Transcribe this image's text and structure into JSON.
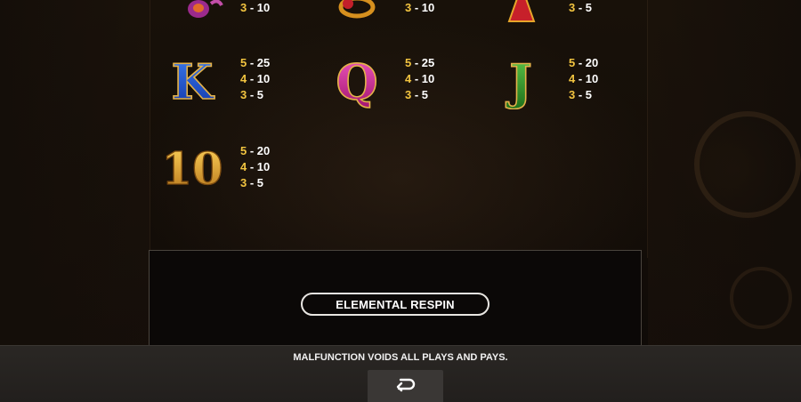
{
  "paytable": {
    "partial_row": [
      {
        "symbol": "scarab-icon",
        "pays": [
          {
            "count": "3",
            "value": "10"
          }
        ]
      },
      {
        "symbol": "ring-icon",
        "pays": [
          {
            "count": "3",
            "value": "10"
          }
        ]
      },
      {
        "symbol": "letter-a-icon",
        "pays": [
          {
            "count": "3",
            "value": "5"
          }
        ]
      }
    ],
    "row1": [
      {
        "symbol": "letter-k-icon",
        "glyph": "K",
        "color": "#1d57d6",
        "pays": [
          {
            "count": "5",
            "value": "25"
          },
          {
            "count": "4",
            "value": "10"
          },
          {
            "count": "3",
            "value": "5"
          }
        ]
      },
      {
        "symbol": "letter-q-icon",
        "glyph": "Q",
        "color": "#d82aa0",
        "pays": [
          {
            "count": "5",
            "value": "25"
          },
          {
            "count": "4",
            "value": "10"
          },
          {
            "count": "3",
            "value": "5"
          }
        ]
      },
      {
        "symbol": "letter-j-icon",
        "glyph": "J",
        "color": "#2f9a2a",
        "pays": [
          {
            "count": "5",
            "value": "20"
          },
          {
            "count": "4",
            "value": "10"
          },
          {
            "count": "3",
            "value": "5"
          }
        ]
      }
    ],
    "row2": [
      {
        "symbol": "number-10-icon",
        "glyph": "10",
        "color": "#e0a52a",
        "pays": [
          {
            "count": "5",
            "value": "20"
          },
          {
            "count": "4",
            "value": "10"
          },
          {
            "count": "3",
            "value": "5"
          }
        ]
      }
    ],
    "dash": "-"
  },
  "section_button_label": "ELEMENTAL RESPIN",
  "footer": {
    "disclaimer": "MALFUNCTION VOIDS ALL PLAYS AND PAYS."
  },
  "colors": {
    "count_gold": "#f2c440",
    "value_white": "#ffffff",
    "footer_bg": "#2a2724"
  }
}
